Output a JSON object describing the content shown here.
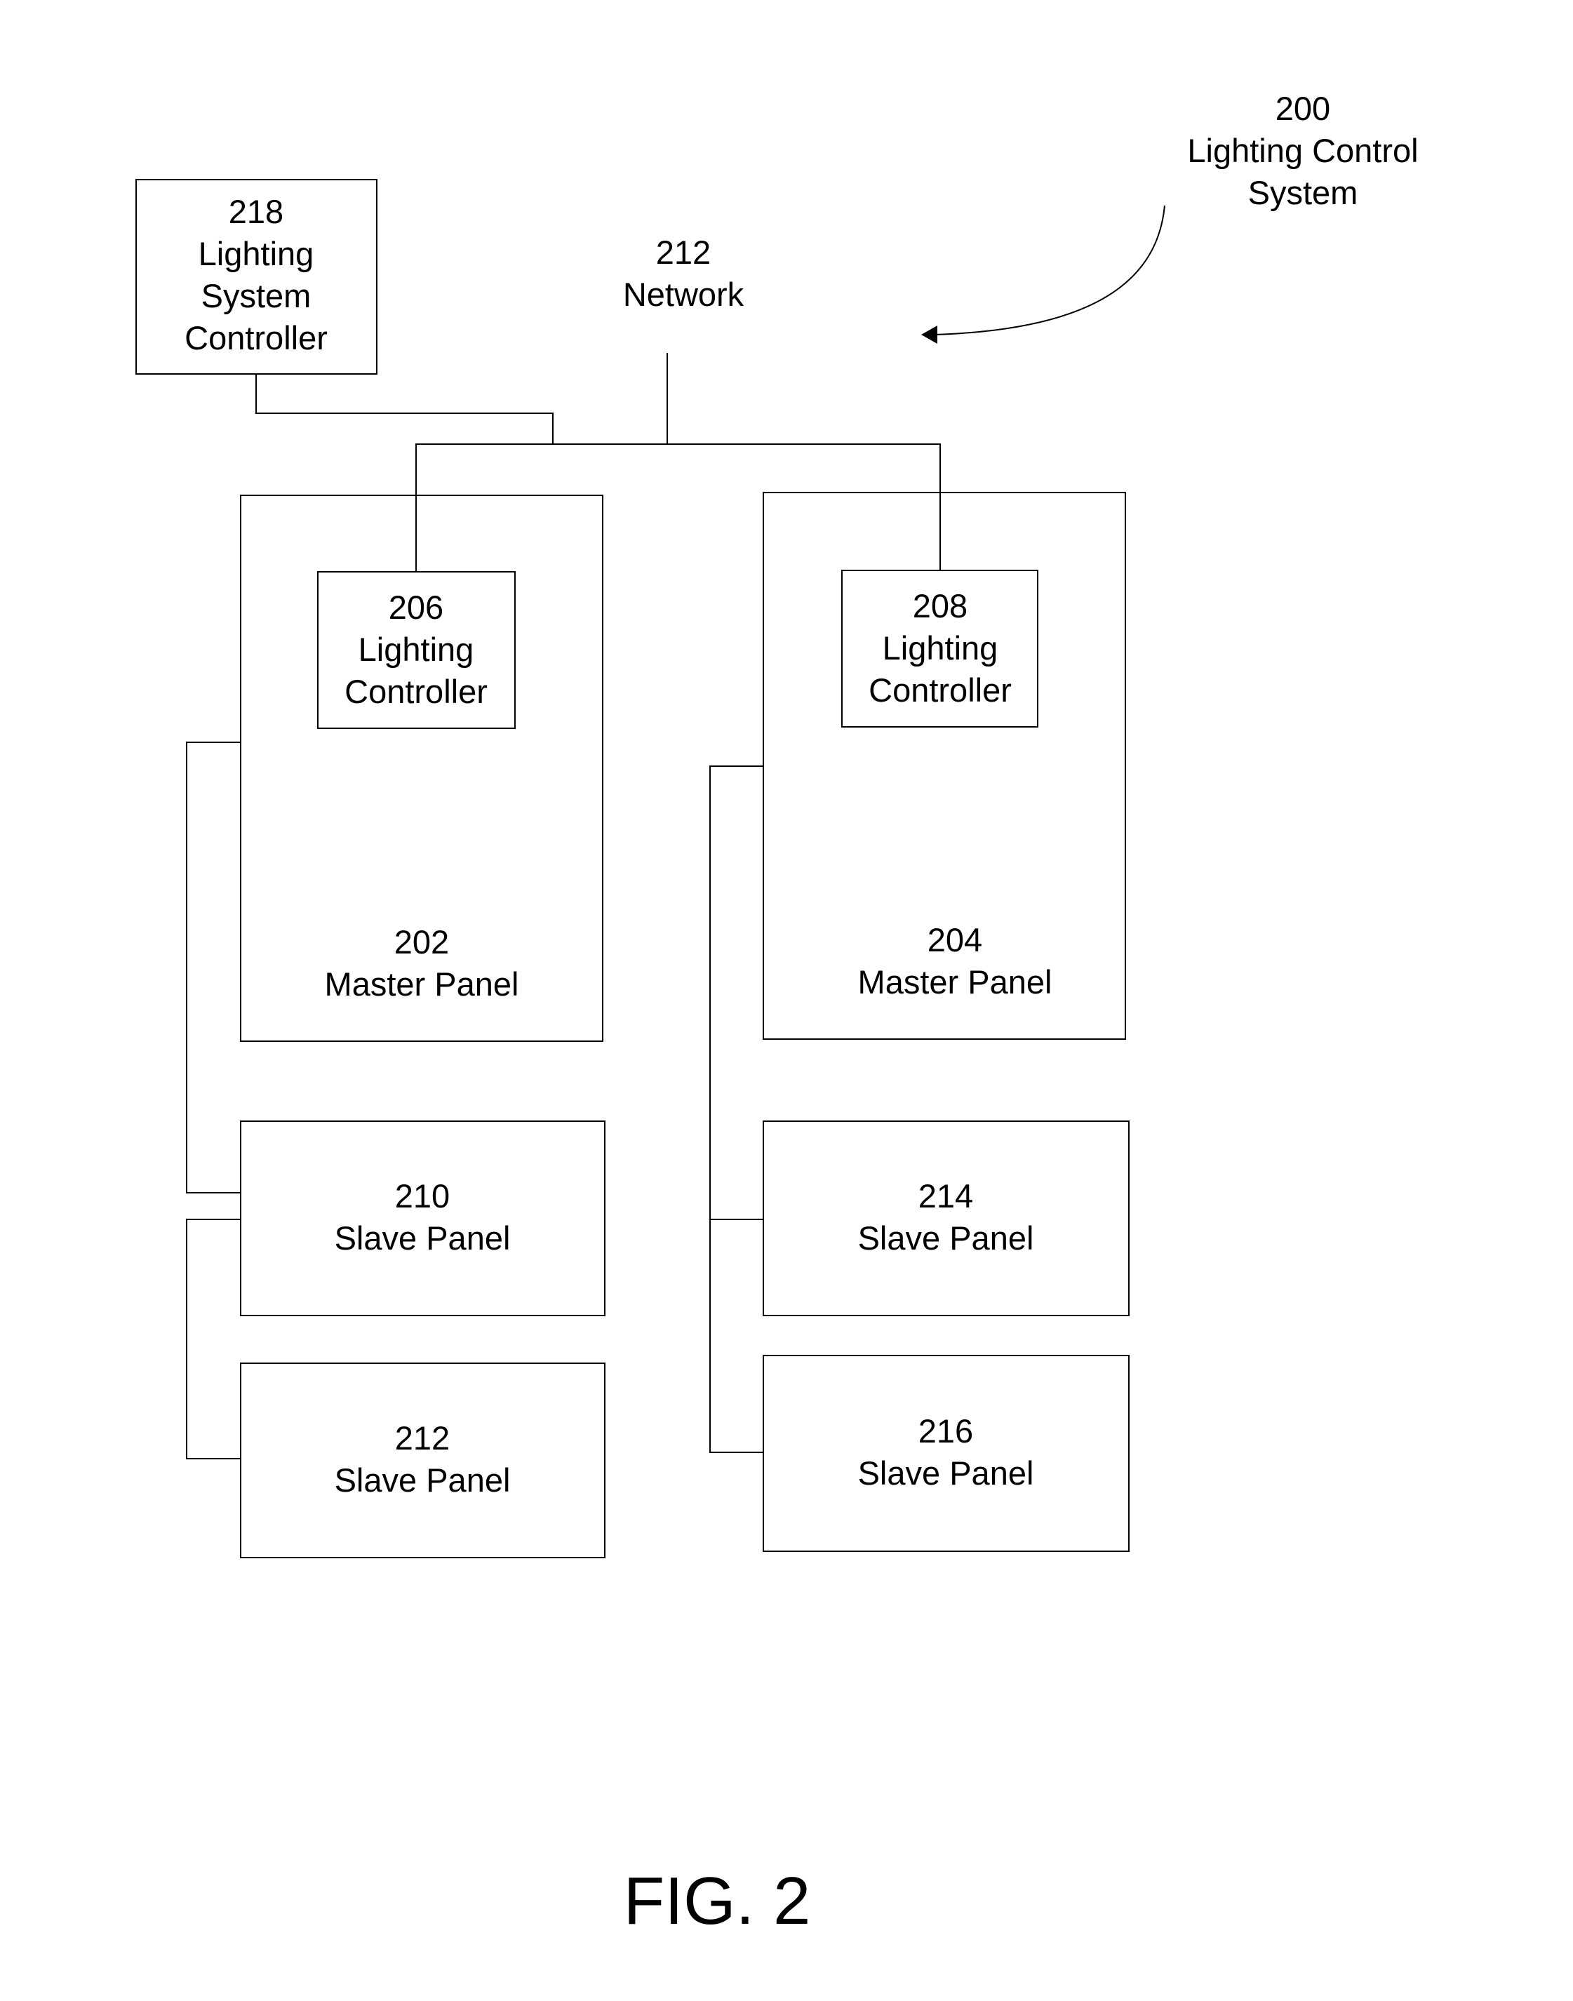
{
  "figure_label": "FIG. 2",
  "system": {
    "number": "200",
    "name_line1": "Lighting Control",
    "name_line2": "System"
  },
  "network": {
    "number": "212",
    "name": "Network"
  },
  "system_controller": {
    "number": "218",
    "line1": "Lighting",
    "line2": "System",
    "line3": "Controller"
  },
  "master_panels": [
    {
      "number": "202",
      "name": "Master Panel",
      "controller": {
        "number": "206",
        "line1": "Lighting",
        "line2": "Controller"
      }
    },
    {
      "number": "204",
      "name": "Master Panel",
      "controller": {
        "number": "208",
        "line1": "Lighting",
        "line2": "Controller"
      }
    }
  ],
  "slave_panels": [
    {
      "number": "210",
      "name": "Slave Panel"
    },
    {
      "number": "212",
      "name": "Slave Panel"
    },
    {
      "number": "214",
      "name": "Slave Panel"
    },
    {
      "number": "216",
      "name": "Slave Panel"
    }
  ]
}
